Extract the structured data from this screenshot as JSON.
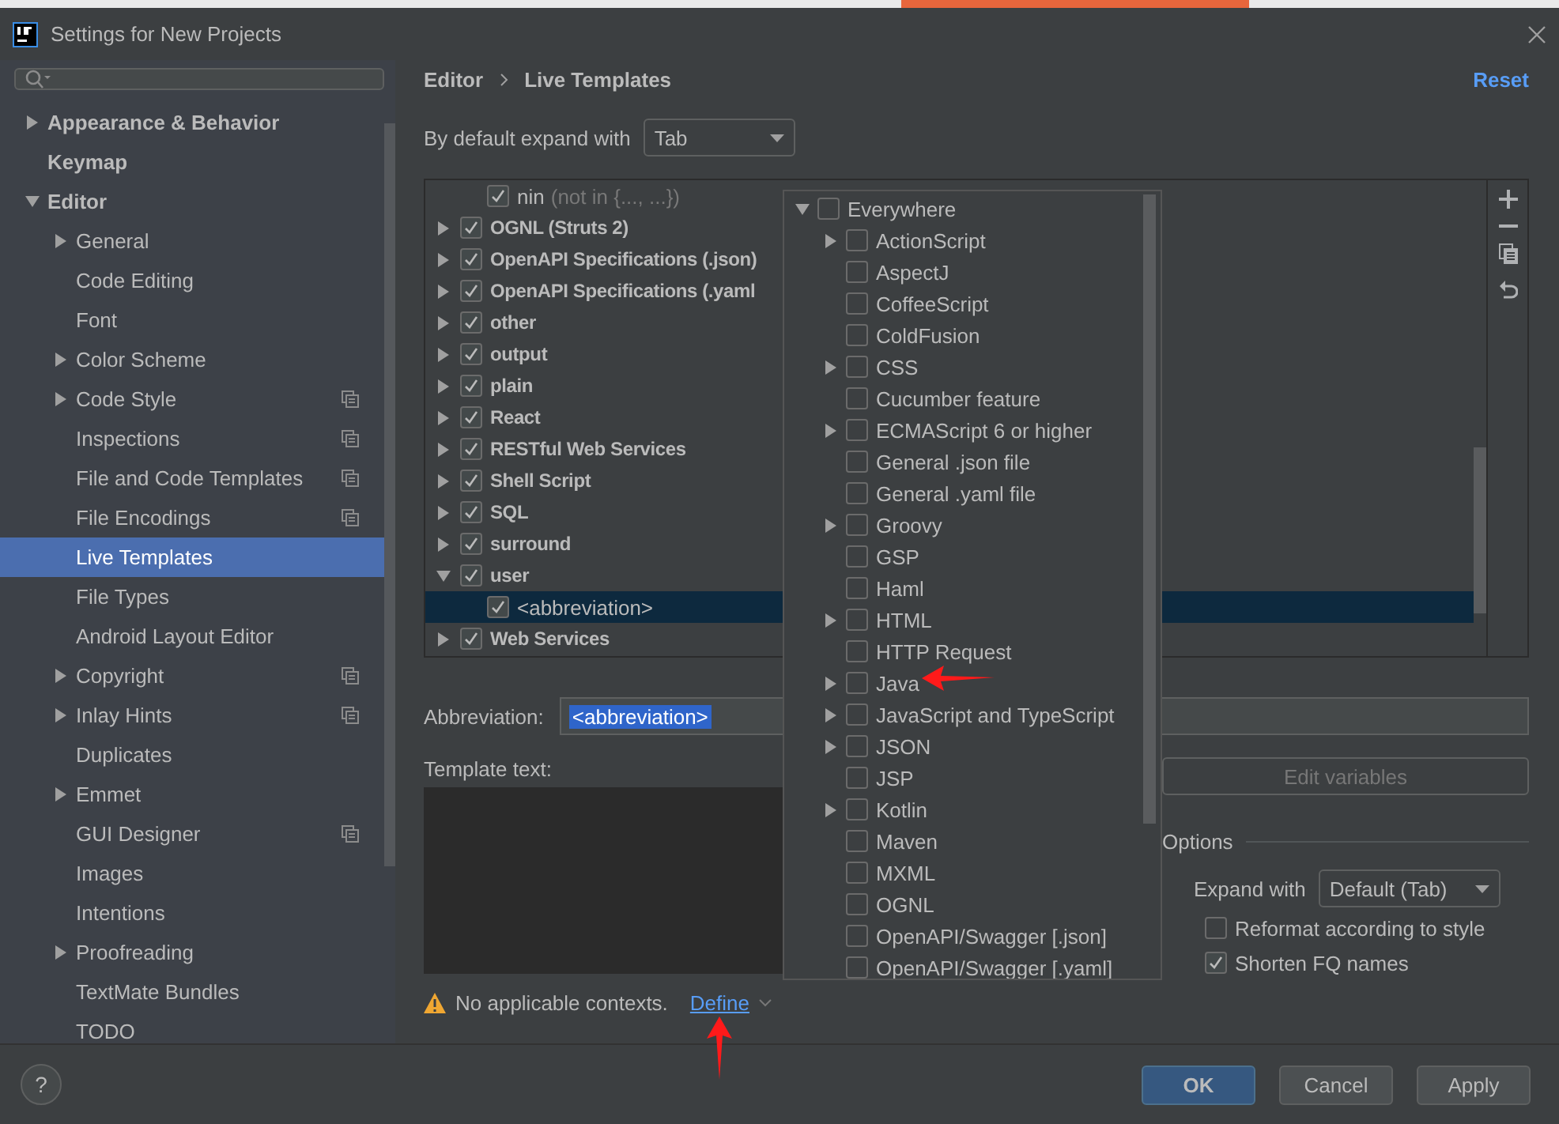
{
  "window": {
    "title": "Settings for New Projects"
  },
  "sidebar": {
    "items": [
      {
        "label": "Appearance & Behavior",
        "expandable": true,
        "expanded": false,
        "selected": false,
        "project_icon": false
      },
      {
        "label": "Keymap",
        "expandable": false,
        "selected": false,
        "project_icon": false
      },
      {
        "label": "Editor",
        "expandable": true,
        "expanded": true,
        "selected": false,
        "project_icon": false,
        "children": [
          {
            "label": "General",
            "expandable": true,
            "expanded": false,
            "selected": false,
            "project_icon": false
          },
          {
            "label": "Code Editing",
            "expandable": false,
            "selected": false,
            "project_icon": false
          },
          {
            "label": "Font",
            "expandable": false,
            "selected": false,
            "project_icon": false
          },
          {
            "label": "Color Scheme",
            "expandable": true,
            "expanded": false,
            "selected": false,
            "project_icon": false
          },
          {
            "label": "Code Style",
            "expandable": true,
            "expanded": false,
            "selected": false,
            "project_icon": true
          },
          {
            "label": "Inspections",
            "expandable": false,
            "selected": false,
            "project_icon": true
          },
          {
            "label": "File and Code Templates",
            "expandable": false,
            "selected": false,
            "project_icon": true
          },
          {
            "label": "File Encodings",
            "expandable": false,
            "selected": false,
            "project_icon": true
          },
          {
            "label": "Live Templates",
            "expandable": false,
            "selected": true,
            "project_icon": false
          },
          {
            "label": "File Types",
            "expandable": false,
            "selected": false,
            "project_icon": false
          },
          {
            "label": "Android Layout Editor",
            "expandable": false,
            "selected": false,
            "project_icon": false
          },
          {
            "label": "Copyright",
            "expandable": true,
            "expanded": false,
            "selected": false,
            "project_icon": true
          },
          {
            "label": "Inlay Hints",
            "expandable": true,
            "expanded": false,
            "selected": false,
            "project_icon": true
          },
          {
            "label": "Duplicates",
            "expandable": false,
            "selected": false,
            "project_icon": false
          },
          {
            "label": "Emmet",
            "expandable": true,
            "expanded": false,
            "selected": false,
            "project_icon": false
          },
          {
            "label": "GUI Designer",
            "expandable": false,
            "selected": false,
            "project_icon": true
          },
          {
            "label": "Images",
            "expandable": false,
            "selected": false,
            "project_icon": false
          },
          {
            "label": "Intentions",
            "expandable": false,
            "selected": false,
            "project_icon": false
          },
          {
            "label": "Proofreading",
            "expandable": true,
            "expanded": false,
            "selected": false,
            "project_icon": false
          },
          {
            "label": "TextMate Bundles",
            "expandable": false,
            "selected": false,
            "project_icon": false
          },
          {
            "label": "TODO",
            "expandable": false,
            "selected": false,
            "project_icon": false
          }
        ]
      }
    ]
  },
  "breadcrumb": [
    "Editor",
    "Live Templates"
  ],
  "reset": "Reset",
  "default_expand": {
    "label": "By default expand with",
    "value": "Tab"
  },
  "templates": [
    {
      "kind": "template",
      "name": "nin",
      "description": "(not in {..., ...})",
      "checked": true,
      "selected": false
    },
    {
      "kind": "group",
      "name": "OGNL (Struts 2)",
      "expandable": true,
      "expanded": false,
      "checked": true,
      "selected": false
    },
    {
      "kind": "group",
      "name": "OpenAPI Specifications (.json)",
      "expandable": true,
      "expanded": false,
      "checked": true,
      "selected": false
    },
    {
      "kind": "group",
      "name": "OpenAPI Specifications (.yaml",
      "expandable": true,
      "expanded": false,
      "checked": true,
      "selected": false
    },
    {
      "kind": "group",
      "name": "other",
      "expandable": true,
      "expanded": false,
      "checked": true,
      "selected": false
    },
    {
      "kind": "group",
      "name": "output",
      "expandable": true,
      "expanded": false,
      "checked": true,
      "selected": false
    },
    {
      "kind": "group",
      "name": "plain",
      "expandable": true,
      "expanded": false,
      "checked": true,
      "selected": false
    },
    {
      "kind": "group",
      "name": "React",
      "expandable": true,
      "expanded": false,
      "checked": true,
      "selected": false
    },
    {
      "kind": "group",
      "name": "RESTful Web Services",
      "expandable": true,
      "expanded": false,
      "checked": true,
      "selected": false
    },
    {
      "kind": "group",
      "name": "Shell Script",
      "expandable": true,
      "expanded": false,
      "checked": true,
      "selected": false
    },
    {
      "kind": "group",
      "name": "SQL",
      "expandable": true,
      "expanded": false,
      "checked": true,
      "selected": false
    },
    {
      "kind": "group",
      "name": "surround",
      "expandable": true,
      "expanded": false,
      "checked": true,
      "selected": false
    },
    {
      "kind": "group",
      "name": "user",
      "expandable": true,
      "expanded": true,
      "checked": true,
      "selected": false
    },
    {
      "kind": "template",
      "name": "<abbreviation>",
      "checked": true,
      "selected": true
    },
    {
      "kind": "group",
      "name": "Web Services",
      "expandable": true,
      "expanded": false,
      "checked": true,
      "selected": false
    }
  ],
  "toolbar": [
    {
      "kind": "add"
    },
    {
      "kind": "remove"
    },
    {
      "kind": "copy"
    },
    {
      "kind": "restore"
    }
  ],
  "abbreviation": {
    "label": "Abbreviation:",
    "value": "<abbreviation>",
    "value_selected": true
  },
  "template_text": {
    "label": "Template text:"
  },
  "edit_variables": {
    "label": "Edit variables",
    "disabled": true
  },
  "options": {
    "title": "Options",
    "expand_label": "Expand with",
    "expand_value": "Default (Tab)",
    "checkboxes": [
      {
        "label": "Reformat according to style",
        "checked": false
      },
      {
        "label": "Shorten FQ names",
        "checked": true
      }
    ]
  },
  "warning": {
    "text": "No applicable contexts.",
    "link": "Define"
  },
  "contexts": [
    {
      "label": "Everywhere",
      "expandable": true,
      "expanded": true,
      "checked": false,
      "children": [
        {
          "label": "ActionScript",
          "expandable": true,
          "expanded": false,
          "checked": false
        },
        {
          "label": "AspectJ",
          "expandable": false,
          "checked": false
        },
        {
          "label": "CoffeeScript",
          "expandable": false,
          "checked": false
        },
        {
          "label": "ColdFusion",
          "expandable": false,
          "checked": false
        },
        {
          "label": "CSS",
          "expandable": true,
          "expanded": false,
          "checked": false
        },
        {
          "label": "Cucumber feature",
          "expandable": false,
          "checked": false
        },
        {
          "label": "ECMAScript 6 or higher",
          "expandable": true,
          "expanded": false,
          "checked": false
        },
        {
          "label": "General .json file",
          "expandable": false,
          "checked": false
        },
        {
          "label": "General .yaml file",
          "expandable": false,
          "checked": false
        },
        {
          "label": "Groovy",
          "expandable": true,
          "expanded": false,
          "checked": false
        },
        {
          "label": "GSP",
          "expandable": false,
          "checked": false
        },
        {
          "label": "Haml",
          "expandable": false,
          "checked": false
        },
        {
          "label": "HTML",
          "expandable": true,
          "expanded": false,
          "checked": false
        },
        {
          "label": "HTTP Request",
          "expandable": false,
          "checked": false
        },
        {
          "label": "Java",
          "expandable": true,
          "expanded": false,
          "checked": false
        },
        {
          "label": "JavaScript and TypeScript",
          "expandable": true,
          "expanded": false,
          "checked": false
        },
        {
          "label": "JSON",
          "expandable": true,
          "expanded": false,
          "checked": false
        },
        {
          "label": "JSP",
          "expandable": false,
          "checked": false
        },
        {
          "label": "Kotlin",
          "expandable": true,
          "expanded": false,
          "checked": false
        },
        {
          "label": "Maven",
          "expandable": false,
          "checked": false
        },
        {
          "label": "MXML",
          "expandable": false,
          "checked": false
        },
        {
          "label": "OGNL",
          "expandable": false,
          "checked": false
        },
        {
          "label": "OpenAPI/Swagger [.json]",
          "expandable": false,
          "checked": false
        },
        {
          "label": "OpenAPI/Swagger [.yaml]",
          "expandable": false,
          "checked": false
        }
      ]
    }
  ],
  "help": "?",
  "buttons": [
    {
      "label": "OK",
      "kind": "default"
    },
    {
      "label": "Cancel",
      "kind": "normal"
    },
    {
      "label": "Apply",
      "kind": "normal"
    }
  ]
}
